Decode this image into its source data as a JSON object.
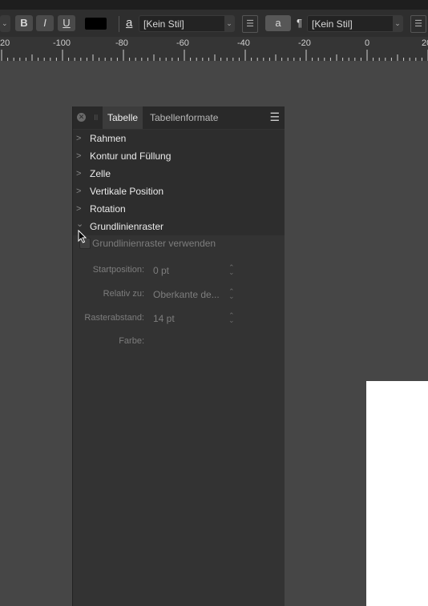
{
  "toolbar": {
    "bold_label": "B",
    "italic_label": "I",
    "underline_label": "U",
    "text_color": "#000000",
    "char_style_icon": "a",
    "char_style_value": "[Kein Stil]",
    "char_style_indicator": "a",
    "para_style_icon": "¶",
    "para_style_value": "[Kein Stil]"
  },
  "ruler": {
    "labels": [
      "20",
      "-100",
      "-80",
      "-60",
      "-40",
      "-20",
      "0",
      "20"
    ]
  },
  "panel": {
    "tabs": [
      {
        "label": "Tabelle",
        "active": true
      },
      {
        "label": "Tabellenformate",
        "active": false
      }
    ],
    "sections": [
      {
        "label": "Rahmen",
        "expanded": false
      },
      {
        "label": "Kontur und Füllung",
        "expanded": false
      },
      {
        "label": "Zelle",
        "expanded": false
      },
      {
        "label": "Vertikale Position",
        "expanded": false
      },
      {
        "label": "Rotation",
        "expanded": false
      },
      {
        "label": "Grundlinienraster",
        "expanded": true
      }
    ],
    "baseline_grid": {
      "use_checkbox_label": "Grundlinienraster verwenden",
      "use_checked": false,
      "start_label": "Startposition:",
      "start_value": "0 pt",
      "relative_label": "Relativ zu:",
      "relative_value": "Oberkante de...",
      "spacing_label": "Rasterabstand:",
      "spacing_value": "14 pt",
      "color_label": "Farbe:"
    }
  }
}
